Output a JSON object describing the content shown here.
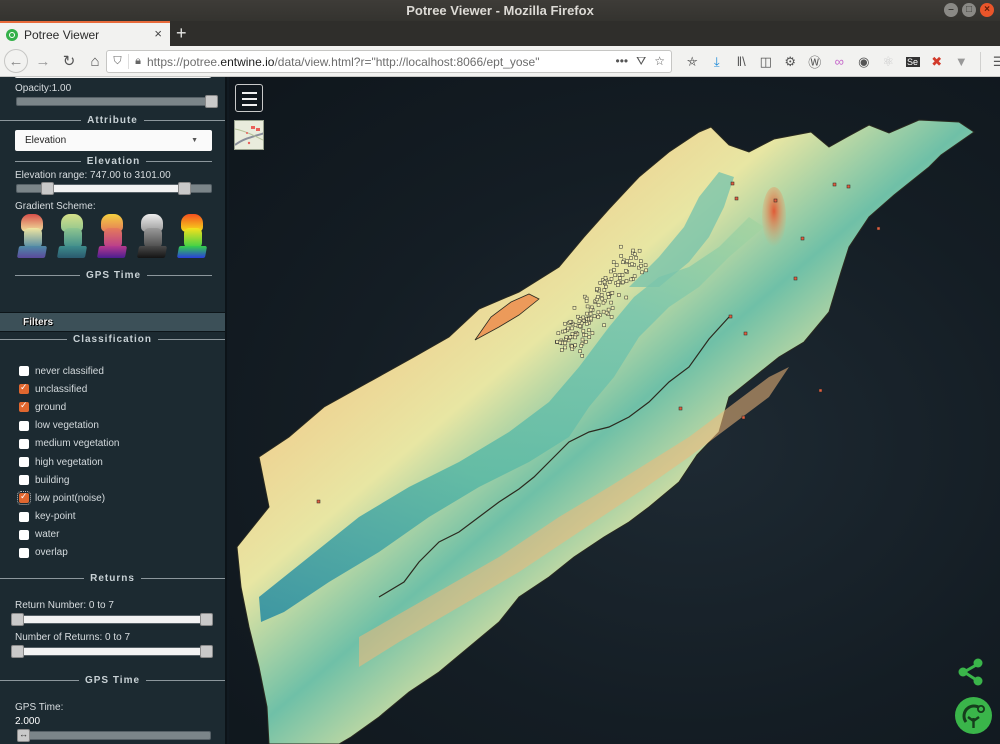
{
  "window": {
    "title": "Potree Viewer - Mozilla Firefox",
    "controls": [
      "minimize",
      "maximize",
      "close"
    ]
  },
  "browser": {
    "tab_title": "Potree Viewer",
    "new_tab_label": "+",
    "url_scheme": "https://potree.",
    "url_host": "entwine.io",
    "url_rest": "/data/view.html?r=\"http://localhost:8066/ept_yose\"",
    "url_actions": [
      "•••",
      "pocket-icon",
      "bookmark-star-icon"
    ],
    "toolbar_icons": [
      "reader-save-icon",
      "download-icon",
      "library-icon",
      "sidebar-icon",
      "extension-gear-icon",
      "extension-w-icon",
      "extension-glasses-icon",
      "account-icon",
      "extension-react-icon",
      "extension-se-icon",
      "extension-x-icon",
      "extension-v-icon",
      "menu-icon"
    ]
  },
  "sidebar": {
    "opacity_label": "Opacity:1.00",
    "opacity_value": 1.0,
    "attribute_header": "Attribute",
    "attribute_select": "Elevation",
    "elevation_header": "Elevation",
    "elevation_range_label": "Elevation range: 747.00 to 3101.00",
    "elevation_range": {
      "min": 747.0,
      "max": 3101.0,
      "low_fraction": 0.14,
      "high_fraction": 0.86
    },
    "gradient_label": "Gradient Scheme:",
    "gradients": [
      {
        "name": "spectral",
        "colors": [
          "#d7504a",
          "#f1e6a0",
          "#4f8aa7",
          "#5a4a9c"
        ]
      },
      {
        "name": "yellow-green",
        "colors": [
          "#d5e089",
          "#8fc58f",
          "#3e8c8c",
          "#2a5a6e"
        ]
      },
      {
        "name": "plasma",
        "colors": [
          "#f4d03f",
          "#e57b5a",
          "#b73a8e",
          "#4c1d8f"
        ]
      },
      {
        "name": "grayscale",
        "colors": [
          "#ededed",
          "#9a9a9a",
          "#4a4a4a",
          "#141414"
        ]
      },
      {
        "name": "rainbow",
        "colors": [
          "#f4501e",
          "#f7e11c",
          "#36d04a",
          "#2a3ddb"
        ]
      }
    ],
    "gps_header_1": "GPS Time",
    "filters_label": "Filters",
    "classification_header": "Classification",
    "classifications": [
      {
        "label": "never classified",
        "checked": false
      },
      {
        "label": "unclassified",
        "checked": true
      },
      {
        "label": "ground",
        "checked": true
      },
      {
        "label": "low vegetation",
        "checked": false
      },
      {
        "label": "medium vegetation",
        "checked": false
      },
      {
        "label": "high vegetation",
        "checked": false
      },
      {
        "label": "building",
        "checked": false
      },
      {
        "label": "low point(noise)",
        "checked": true,
        "focused": true
      },
      {
        "label": "key-point",
        "checked": false
      },
      {
        "label": "water",
        "checked": false
      },
      {
        "label": "overlap",
        "checked": false
      }
    ],
    "returns_header": "Returns",
    "return_number_label": "Return Number: 0 to 7",
    "return_number": {
      "min": 0,
      "max": 7
    },
    "number_of_returns_label": "Number of Returns: 0 to 7",
    "number_of_returns": {
      "min": 0,
      "max": 7
    },
    "gps_header_2": "GPS Time",
    "gps_time_label": "GPS Time:",
    "gps_time_value": "2.000"
  },
  "viewer": {
    "menu_button": "menu-icon",
    "map_thumbnail": "map-thumbnail",
    "share_icon": "share-icon",
    "logo": "potree-logo"
  },
  "colors": {
    "sidebar_bg": "#1c2a31",
    "accent_check": "#e0672f",
    "logo_green": "#3ab54a",
    "viewer_bg": "#141d24"
  }
}
